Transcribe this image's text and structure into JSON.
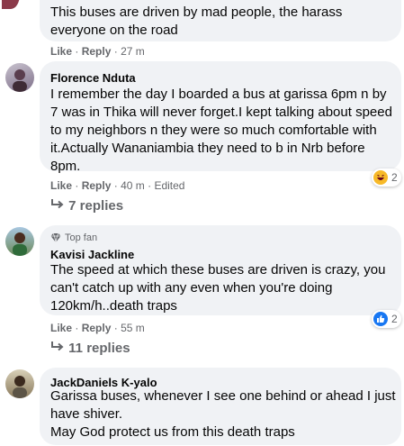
{
  "comments": [
    {
      "text": "This buses are driven by mad people, the harass\neveryone on the road",
      "actions": {
        "like": "Like",
        "sep1": "·",
        "reply": "Reply",
        "sep2": "·",
        "time": "27 m"
      }
    },
    {
      "author": "Florence Nduta",
      "text": "I remember the day I boarded a bus at garissa 6pm n by\n7 was in Thika will never forget.I kept talking about speed\nto my neighbors n they were so much comfortable with\nit.Actually Wananiambia they need to b in Nrb before\n8pm.",
      "actions": {
        "like": "Like",
        "sep1": "·",
        "reply": "Reply",
        "sep2": "·",
        "time": "40 m",
        "sep3": "·",
        "edited": "Edited"
      },
      "reaction": {
        "type": "haha",
        "count": "2"
      },
      "replies": "7 replies"
    },
    {
      "badge": "Top fan",
      "author": "Kavisi Jackline",
      "text": "The speed at which these buses are driven is crazy, you\ncan't catch up with any even when you're doing\n120km/h..death traps",
      "actions": {
        "like": "Like",
        "sep1": "·",
        "reply": "Reply",
        "sep2": "·",
        "time": "55 m"
      },
      "reaction": {
        "type": "like",
        "count": "2"
      },
      "replies": "11 replies"
    },
    {
      "author": "JackDaniels K-yalo",
      "text": "Garissa buses, whenever I see one behind or ahead I just\nhave shiver.\nMay God protect us from this death traps"
    }
  ],
  "colors": {
    "bubble": "#f0f2f5",
    "meta": "#65676b",
    "like_blue": "#1877f2",
    "haha_yellow": "#f7b928"
  }
}
